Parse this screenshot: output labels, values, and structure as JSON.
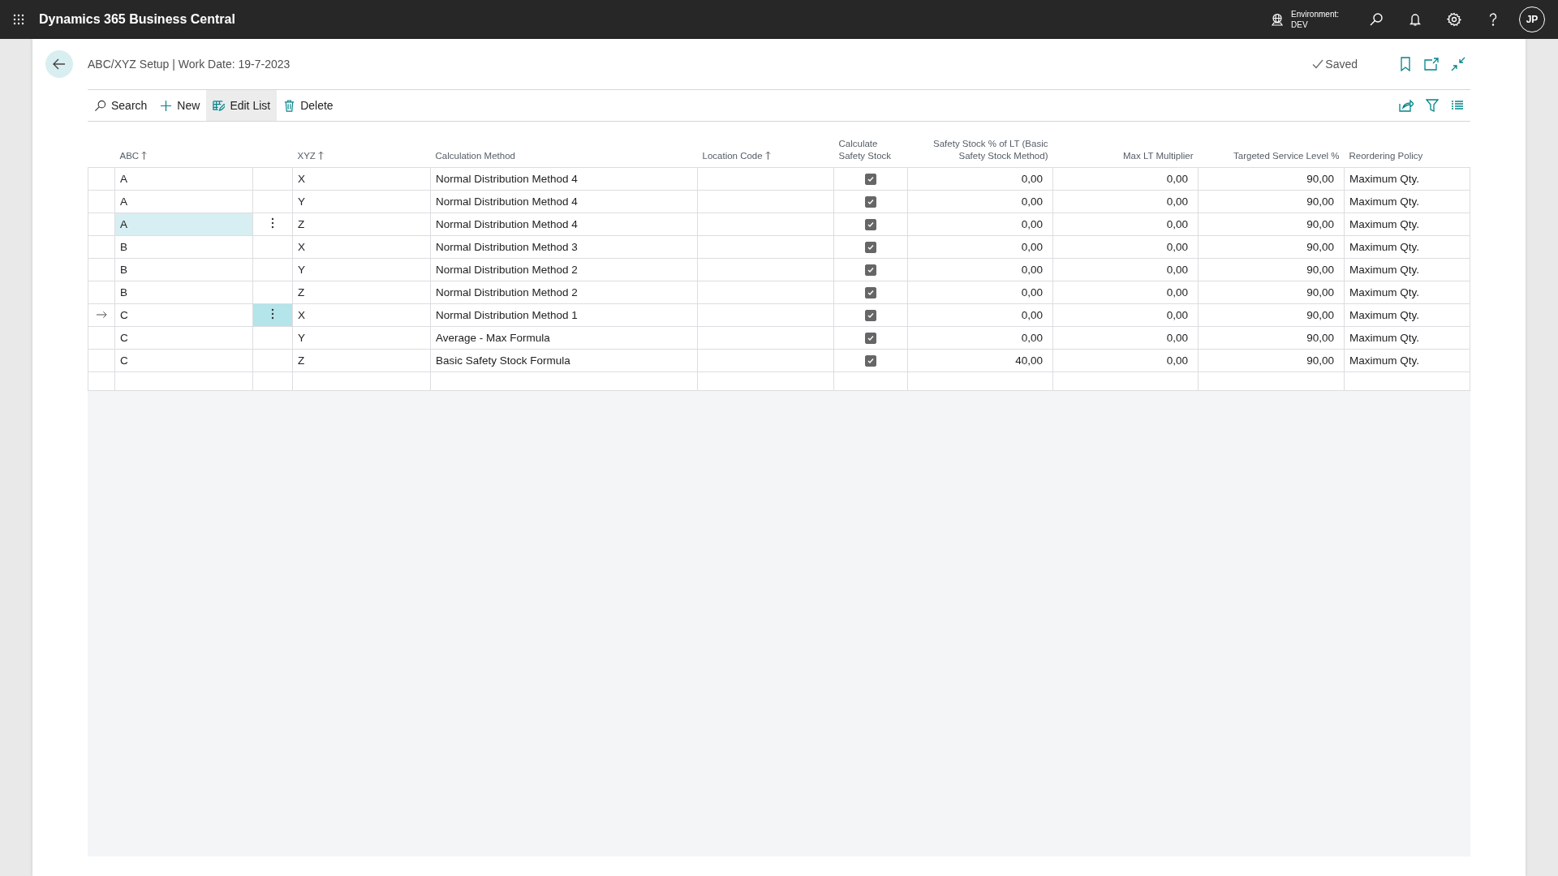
{
  "app": {
    "title": "Dynamics 365 Business Central",
    "environment_label": "Environment:",
    "environment": "DEV",
    "avatar": "JP"
  },
  "page": {
    "title": "ABC/XYZ Setup | Work Date: 19-7-2023",
    "status": "Saved"
  },
  "actions": [
    {
      "label": "Search",
      "kind": "search",
      "selected": false
    },
    {
      "label": "New",
      "kind": "new",
      "selected": false
    },
    {
      "label": "Edit List",
      "kind": "edit",
      "selected": true
    },
    {
      "label": "Delete",
      "kind": "delete",
      "selected": false
    }
  ],
  "columns": [
    {
      "label": "ABC",
      "sorted": true
    },
    {
      "label": "XYZ",
      "sorted": true
    },
    {
      "label": "Calculation Method",
      "sorted": false
    },
    {
      "label": "Location Code",
      "sorted": true
    },
    {
      "label": "Calculate Safety Stock",
      "sorted": false
    },
    {
      "label": "Safety Stock % of LT (Basic Safety Stock Method)",
      "sorted": false
    },
    {
      "label": "Max LT Multiplier",
      "sorted": false
    },
    {
      "label": "Targeted Service Level %",
      "sorted": false
    },
    {
      "label": "Reordering Policy",
      "sorted": false
    }
  ],
  "rows": [
    {
      "abc": "A",
      "xyz": "X",
      "method": "Normal Distribution Method 4",
      "calculate": true,
      "safety_pct": "0,00",
      "max_lt": "0,00",
      "service": "90,00",
      "policy": "Maximum Qty.",
      "selected": false,
      "hovered": false
    },
    {
      "abc": "A",
      "xyz": "Y",
      "method": "Normal Distribution Method 4",
      "calculate": true,
      "safety_pct": "0,00",
      "max_lt": "0,00",
      "service": "90,00",
      "policy": "Maximum Qty.",
      "selected": false,
      "hovered": false
    },
    {
      "abc": "A",
      "xyz": "Z",
      "method": "Normal Distribution Method 4",
      "calculate": true,
      "safety_pct": "0,00",
      "max_lt": "0,00",
      "service": "90,00",
      "policy": "Maximum Qty.",
      "selected": false,
      "hovered": true
    },
    {
      "abc": "B",
      "xyz": "X",
      "method": "Normal Distribution Method 3",
      "calculate": true,
      "safety_pct": "0,00",
      "max_lt": "0,00",
      "service": "90,00",
      "policy": "Maximum Qty.",
      "selected": false,
      "hovered": false
    },
    {
      "abc": "B",
      "xyz": "Y",
      "method": "Normal Distribution Method 2",
      "calculate": true,
      "safety_pct": "0,00",
      "max_lt": "0,00",
      "service": "90,00",
      "policy": "Maximum Qty.",
      "selected": false,
      "hovered": false
    },
    {
      "abc": "B",
      "xyz": "Z",
      "method": "Normal Distribution Method 2",
      "calculate": true,
      "safety_pct": "0,00",
      "max_lt": "0,00",
      "service": "90,00",
      "policy": "Maximum Qty.",
      "selected": false,
      "hovered": false
    },
    {
      "abc": "C",
      "xyz": "X",
      "method": "Normal Distribution Method 1",
      "calculate": true,
      "safety_pct": "0,00",
      "max_lt": "0,00",
      "service": "90,00",
      "policy": "Maximum Qty.",
      "selected": true,
      "hovered": false
    },
    {
      "abc": "C",
      "xyz": "Y",
      "method": "Average - Max Formula",
      "calculate": true,
      "safety_pct": "0,00",
      "max_lt": "0,00",
      "service": "90,00",
      "policy": "Maximum Qty.",
      "selected": false,
      "hovered": false
    },
    {
      "abc": "C",
      "xyz": "Z",
      "method": "Basic Safety Stock Formula",
      "calculate": true,
      "safety_pct": "40,00",
      "max_lt": "0,00",
      "service": "90,00",
      "policy": "Maximum Qty.",
      "selected": false,
      "hovered": false
    }
  ]
}
